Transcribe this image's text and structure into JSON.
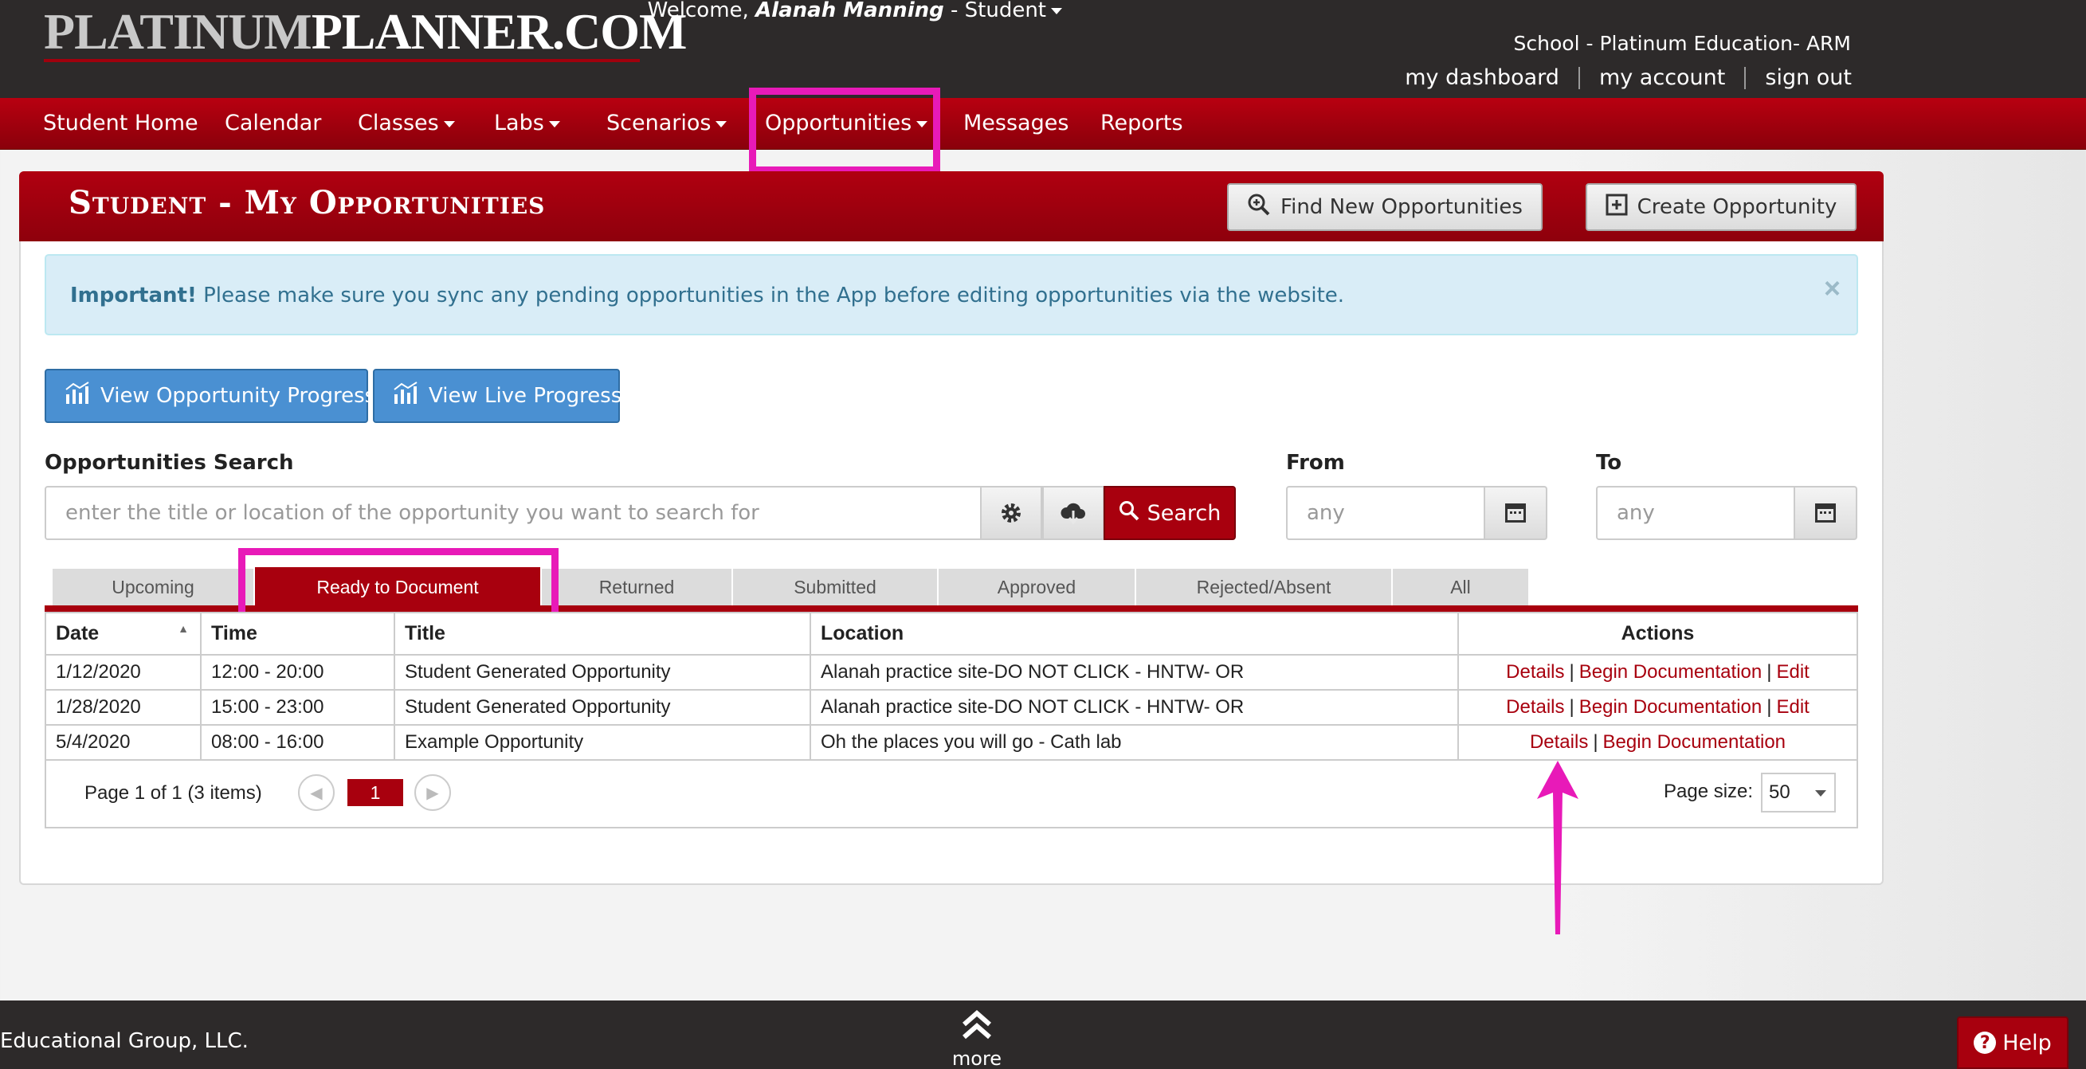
{
  "header": {
    "logo_part1": "PLATINUM",
    "logo_part2": "PLANNER.COM",
    "welcome_prefix": "Welcome, ",
    "user_name": "Alanah Manning",
    "role_suffix": " - Student",
    "school": "School - Platinum Education- ARM",
    "links": [
      "my dashboard",
      "my account",
      "sign out"
    ]
  },
  "nav": {
    "student_home": "Student Home",
    "calendar": "Calendar",
    "classes": "Classes",
    "labs": "Labs",
    "scenarios": "Scenarios",
    "opportunities": "Opportunities",
    "messages": "Messages",
    "reports": "Reports"
  },
  "page": {
    "title": "Student - My Opportunities",
    "find_new": "Find New Opportunities",
    "create": "Create Opportunity"
  },
  "alert": {
    "strong": "Important!",
    "text": " Please make sure you sync any pending opportunities in the App before editing opportunities via the website.",
    "close": "×"
  },
  "progress_buttons": {
    "opportunity": "View Opportunity Progress",
    "live": "View Live Progress"
  },
  "search": {
    "label": "Opportunities Search",
    "placeholder": "enter the title or location of the opportunity you want to search for",
    "button": "Search",
    "from_label": "From",
    "to_label": "To",
    "from_placeholder": "any",
    "to_placeholder": "any"
  },
  "tabs": [
    "Upcoming",
    "Ready to Document",
    "Returned",
    "Submitted",
    "Approved",
    "Rejected/Absent",
    "All"
  ],
  "table": {
    "headers": {
      "date": "Date",
      "time": "Time",
      "title": "Title",
      "location": "Location",
      "actions": "Actions"
    },
    "rows": [
      {
        "date": "1/12/2020",
        "time": "12:00 - 20:00",
        "title": "Student Generated Opportunity",
        "location": "Alanah practice site-DO NOT CLICK - HNTW- OR",
        "details": "Details",
        "begin": "Begin Documentation",
        "edit": "Edit"
      },
      {
        "date": "1/28/2020",
        "time": "15:00 - 23:00",
        "title": "Student Generated Opportunity",
        "location": "Alanah practice site-DO NOT CLICK - HNTW- OR",
        "details": "Details",
        "begin": "Begin Documentation",
        "edit": "Edit"
      },
      {
        "date": "5/4/2020",
        "time": "08:00 - 16:00",
        "title": "Example Opportunity",
        "location": "Oh the places you will go - Cath lab",
        "details": "Details",
        "begin": "Begin Documentation"
      }
    ]
  },
  "pager": {
    "info": "Page 1 of 1 (3 items)",
    "current_page": "1",
    "page_size_label": "Page size:",
    "page_size": "50"
  },
  "footer": {
    "copyright": "Educational Group, LLC.",
    "more": "more",
    "help": "Help"
  },
  "colors": {
    "brand_red": "#a8000e",
    "highlight_magenta": "#e81ab8",
    "alert_bg": "#d9edf7",
    "progress_blue": "#4a90d2"
  }
}
